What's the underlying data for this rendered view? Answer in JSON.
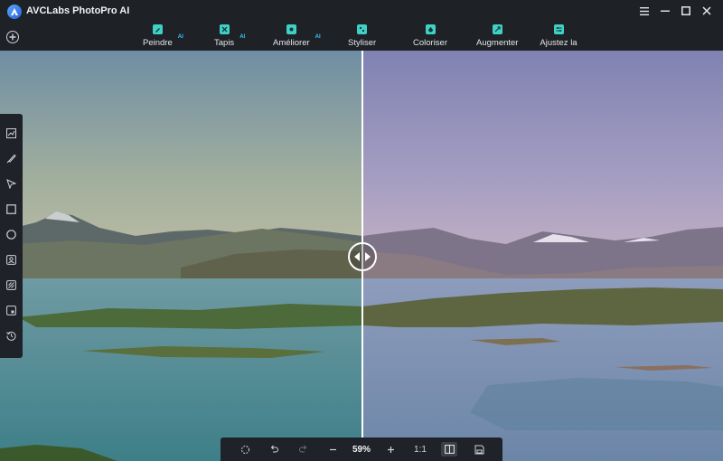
{
  "app": {
    "title": "AVCLabs PhotoPro AI"
  },
  "window_controls": [
    "menu-icon",
    "minimize-icon",
    "maximize-icon",
    "close-icon"
  ],
  "toolbar": {
    "add_icon": "plus-circle-icon",
    "tools": [
      {
        "label": "Peindre",
        "ai_badge": "AI",
        "icon": "paint-icon"
      },
      {
        "label": "Tapis",
        "ai_badge": "AI",
        "icon": "eraser-icon"
      },
      {
        "label": "Améliorer",
        "ai_badge": "AI",
        "icon": "enhance-icon"
      },
      {
        "label": "Styliser",
        "ai_badge": "",
        "icon": "stylize-icon"
      },
      {
        "label": "Coloriser",
        "ai_badge": "",
        "icon": "colorize-icon"
      },
      {
        "label": "Augmenter",
        "ai_badge": "",
        "icon": "upscale-icon"
      },
      {
        "label": "Ajustez la couleur",
        "ai_badge": "",
        "icon": "adjust-icon"
      }
    ]
  },
  "side_tools": [
    "chart-icon",
    "brush-icon",
    "pointer-icon",
    "rect-select-icon",
    "ellipse-select-icon",
    "portrait-icon",
    "pattern-icon",
    "layers-icon",
    "history-icon"
  ],
  "bottom_bar": {
    "zoom": "59%",
    "ratio": "1:1",
    "icons": [
      "reset-icon",
      "undo-icon",
      "redo-icon",
      "zoom-out-icon",
      "zoom-in-icon",
      "compare-icon",
      "save-icon"
    ]
  },
  "colors": {
    "accent": "#3fd0c6",
    "ai_badge": "#39c7ff",
    "background": "#1e2126"
  }
}
